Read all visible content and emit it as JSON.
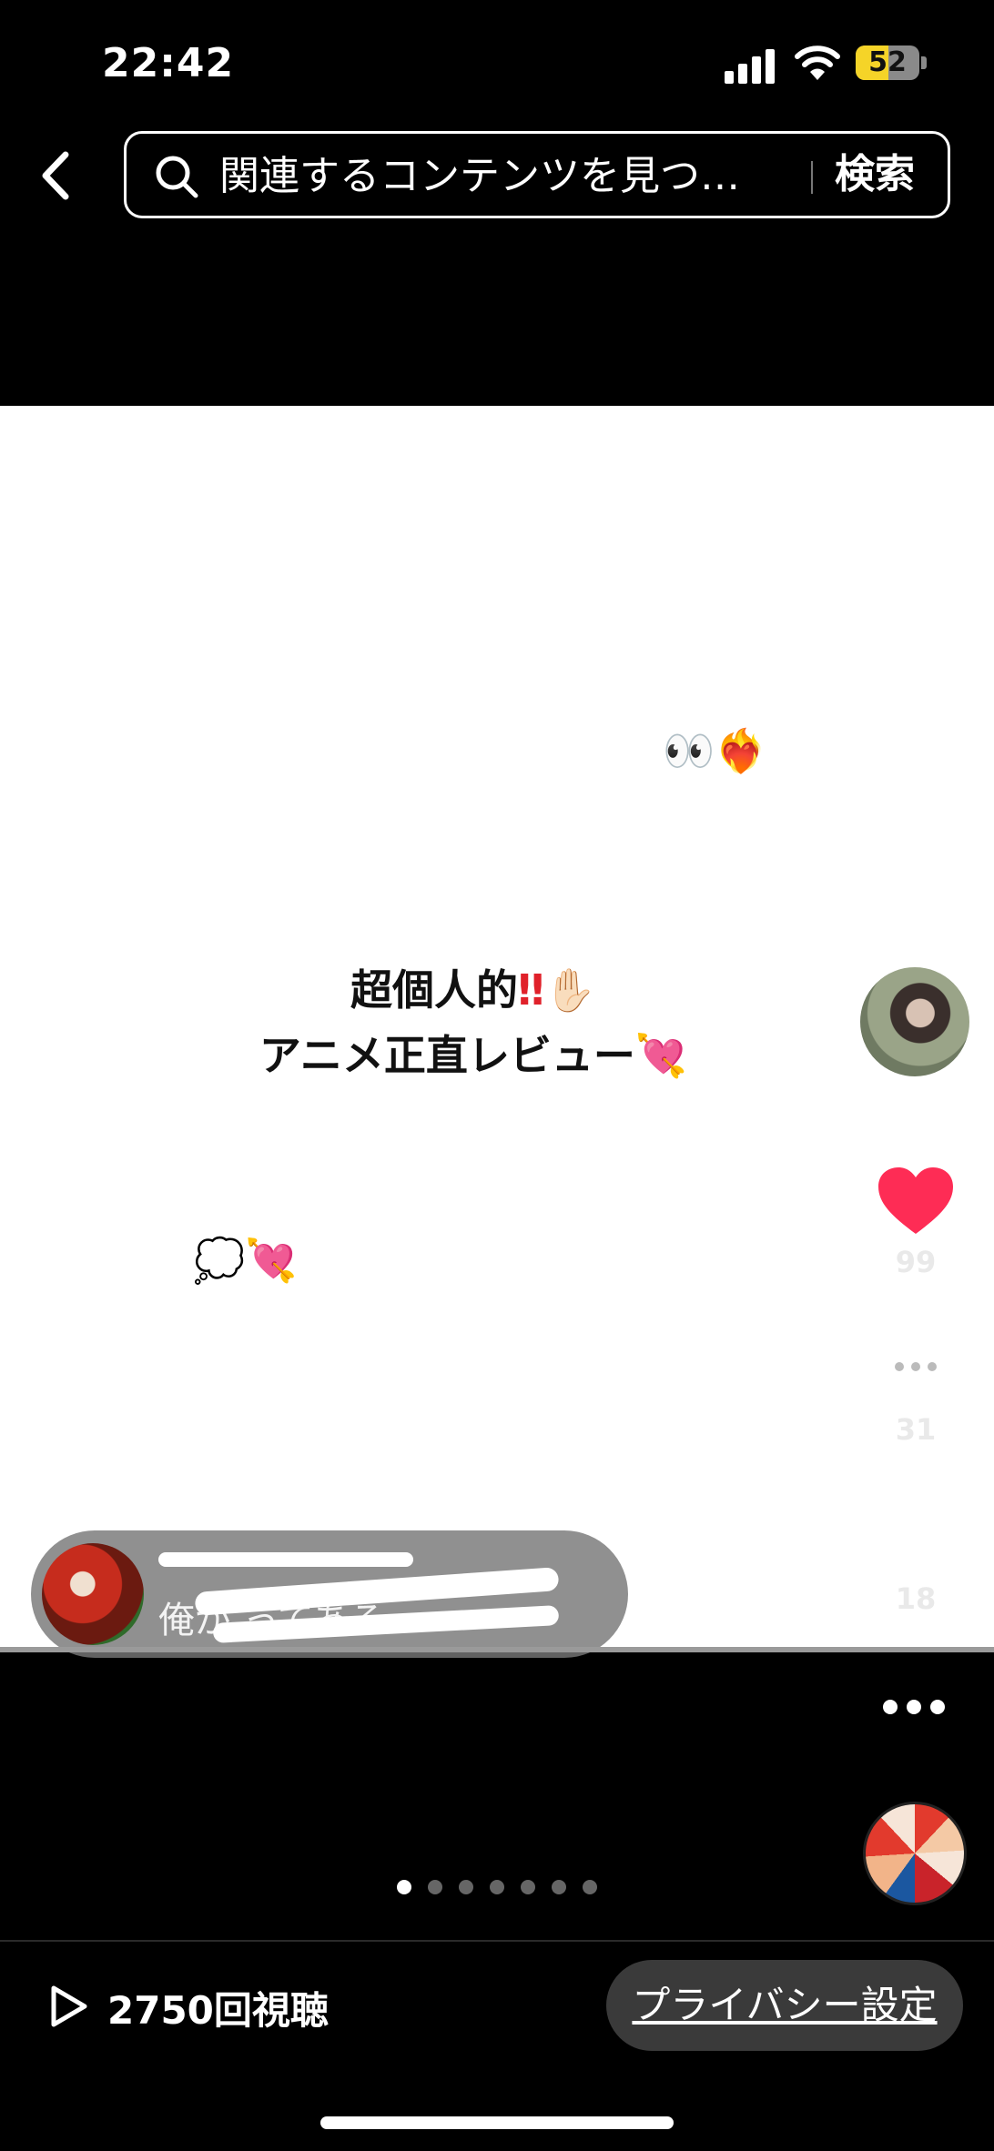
{
  "status_bar": {
    "time": "22:42",
    "battery": "52",
    "battery_level": 0.52
  },
  "search": {
    "placeholder": "関連するコンテンツを見つ…",
    "button_label": "検索"
  },
  "post": {
    "headline_line1": "超個人的",
    "headline_line1_bang": "‼",
    "headline_line1_emoji": "✋🏻",
    "headline_line2": "アニメ正直レビュー",
    "headline_line2_emoji": "💘",
    "deco_top": "👀❤️‍🔥",
    "deco_bottom": "💭💘"
  },
  "actions": {
    "likes": "99",
    "comments": "31",
    "saves": "18"
  },
  "sound_pill": {
    "visible_text": "俺が                    ってある"
  },
  "carousel": {
    "total": 7,
    "active_index": 0
  },
  "footer": {
    "views": "2750回視聴",
    "privacy_label": "プライバシー設定"
  },
  "colors": {
    "like": "#fe2c55",
    "background": "#000000",
    "panel": "#ffffff"
  }
}
